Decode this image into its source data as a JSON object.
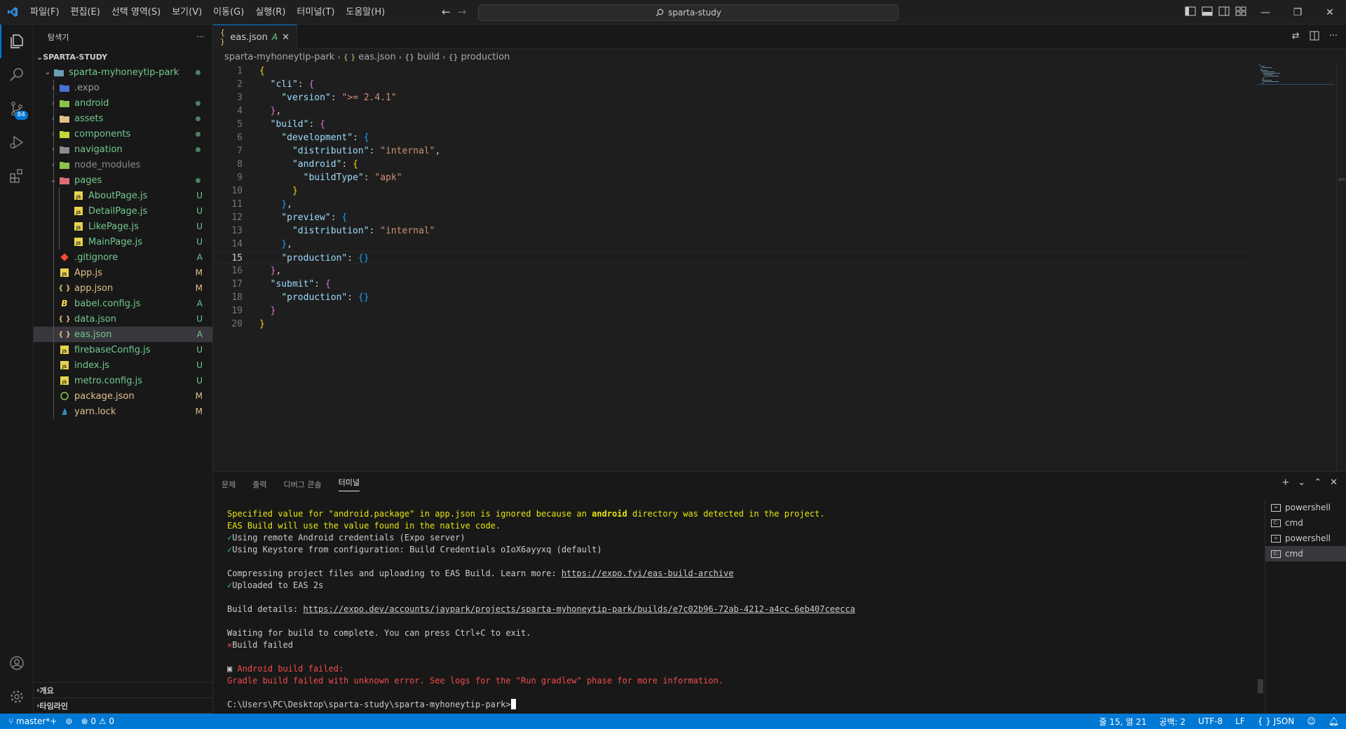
{
  "title_bar": {
    "menu": [
      "파일(F)",
      "편집(E)",
      "선택 영역(S)",
      "보기(V)",
      "이동(G)",
      "실행(R)",
      "터미널(T)",
      "도움말(H)"
    ],
    "search_text": "sparta-study"
  },
  "activity_bar": {
    "scm_badge": "84"
  },
  "sidebar": {
    "title": "탐색기",
    "more": "···",
    "root": "SPARTA-STUDY",
    "project": "sparta-myhoneytip-park",
    "items": [
      {
        "label": ".expo",
        "type": "folder",
        "icon": "expo-folder-icon",
        "color": "#9d9d9d",
        "status": ""
      },
      {
        "label": "android",
        "type": "folder",
        "icon": "android-folder-icon",
        "color": "#73c991",
        "status": "dot"
      },
      {
        "label": "assets",
        "type": "folder",
        "icon": "assets-folder-icon",
        "color": "#73c991",
        "status": "dot"
      },
      {
        "label": "components",
        "type": "folder",
        "icon": "components-folder-icon",
        "color": "#73c991",
        "status": "dot"
      },
      {
        "label": "navigation",
        "type": "folder",
        "icon": "navigation-folder-icon",
        "color": "#73c991",
        "status": "dot"
      },
      {
        "label": "node_modules",
        "type": "folder",
        "icon": "node-modules-folder-icon",
        "color": "#8c8c8c",
        "status": ""
      },
      {
        "label": "pages",
        "type": "folder-open",
        "icon": "pages-folder-icon",
        "color": "#73c991",
        "status": "dot"
      },
      {
        "label": "AboutPage.js",
        "type": "js",
        "icon": "js-file-icon",
        "color": "#73c991",
        "status": "U",
        "indent": 2
      },
      {
        "label": "DetailPage.js",
        "type": "js",
        "icon": "js-file-icon",
        "color": "#73c991",
        "status": "U",
        "indent": 2
      },
      {
        "label": "LikePage.js",
        "type": "js",
        "icon": "js-file-icon",
        "color": "#73c991",
        "status": "U",
        "indent": 2
      },
      {
        "label": "MainPage.js",
        "type": "js",
        "icon": "js-file-icon",
        "color": "#73c991",
        "status": "U",
        "indent": 2
      },
      {
        "label": ".gitignore",
        "type": "git",
        "icon": "git-file-icon",
        "color": "#73c991",
        "status": "A"
      },
      {
        "label": "App.js",
        "type": "js",
        "icon": "js-file-icon",
        "color": "#e2c08d",
        "status": "M"
      },
      {
        "label": "app.json",
        "type": "json",
        "icon": "json-file-icon",
        "color": "#e2c08d",
        "status": "M"
      },
      {
        "label": "babel.config.js",
        "type": "babel",
        "icon": "babel-file-icon",
        "color": "#73c991",
        "status": "A"
      },
      {
        "label": "data.json",
        "type": "json",
        "icon": "json-file-icon",
        "color": "#73c991",
        "status": "U"
      },
      {
        "label": "eas.json",
        "type": "json",
        "icon": "json-file-icon",
        "color": "#73c991",
        "status": "A",
        "selected": true
      },
      {
        "label": "firebaseConfig.js",
        "type": "js",
        "icon": "js-file-icon",
        "color": "#73c991",
        "status": "U"
      },
      {
        "label": "index.js",
        "type": "js",
        "icon": "js-file-icon",
        "color": "#73c991",
        "status": "U"
      },
      {
        "label": "metro.config.js",
        "type": "js",
        "icon": "js-file-icon",
        "color": "#73c991",
        "status": "U"
      },
      {
        "label": "package.json",
        "type": "npm",
        "icon": "npm-file-icon",
        "color": "#e2c08d",
        "status": "M"
      },
      {
        "label": "yarn.lock",
        "type": "yarn",
        "icon": "yarn-file-icon",
        "color": "#e2c08d",
        "status": "M"
      }
    ],
    "outline": "개요",
    "timeline": "타임라인"
  },
  "editor": {
    "tab": {
      "label": "eas.json",
      "status": "A",
      "icon": "{ }"
    },
    "breadcrumb": [
      "sparta-myhoneytip-park",
      "eas.json",
      "build",
      "production"
    ],
    "breadcrumb_icons": [
      "{ }",
      "{}",
      "{}"
    ],
    "current_line": 15
  },
  "panel": {
    "tabs": [
      "문제",
      "출력",
      "디버그 콘솔",
      "터미널"
    ],
    "active_tab": "터미널",
    "terminals": [
      {
        "label": "powershell",
        "icon": "powershell-icon"
      },
      {
        "label": "cmd",
        "icon": "cmd-icon"
      },
      {
        "label": "powershell",
        "icon": "powershell-icon"
      },
      {
        "label": "cmd",
        "icon": "cmd-icon",
        "active": true
      }
    ],
    "terminal": {
      "warn_1a": "Specified value for \"android.package\" in app.json is ignored because an ",
      "warn_1b": "android",
      "warn_1c": " directory was detected in the project.",
      "warn_2": "EAS Build will use the value found in the native code.",
      "check_mark": "✓",
      "check_1": "Using remote Android credentials (Expo server)",
      "check_2": "Using Keystore from configuration: Build Credentials oIoX6ayyxq (default)",
      "compress": "Compressing project files and uploading to EAS Build. Learn more: ",
      "compress_link": "https://expo.fyi/eas-build-archive",
      "uploaded": "Uploaded to EAS 2s",
      "details": "Build details: ",
      "details_link": "https://expo.dev/accounts/jaypark/projects/sparta-myhoneytip-park/builds/e7c02b96-72ab-4212-a4cc-6eb407ceecca",
      "waiting": "Waiting for build to complete. You can press Ctrl+C to exit.",
      "cross_mark": "✕",
      "failed": "Build failed",
      "android_failed": "Android build failed:",
      "gradle": "Gradle build failed with unknown error. See logs for the \"Run gradlew\" phase for more information.",
      "prompt": "C:\\Users\\PC\\Desktop\\sparta-study\\sparta-myhoneytip-park>"
    }
  },
  "status_bar": {
    "branch": "master*+",
    "errors": "0",
    "warnings": "0",
    "position": "줄 15, 열 21",
    "spaces": "공백: 2",
    "encoding": "UTF-8",
    "eol": "LF",
    "language": "JSON",
    "language_icon": "{ }"
  },
  "colors": {
    "accent": "#0078d4",
    "added": "#73c991",
    "modified": "#e2c08d",
    "error": "#f14c4c",
    "warning": "#e5e510"
  }
}
